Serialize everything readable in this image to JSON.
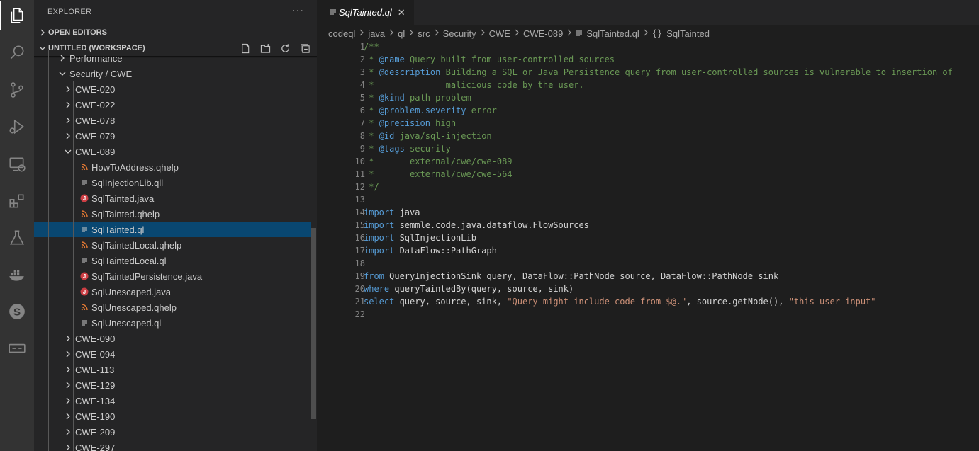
{
  "sidebar": {
    "title": "EXPLORER",
    "more": "···",
    "open_editors": "OPEN EDITORS",
    "workspace": "UNTITLED (WORKSPACE)",
    "tree": [
      {
        "label": "Performance",
        "kind": "folder",
        "depth": 2,
        "expanded": false
      },
      {
        "label": "Security / CWE",
        "kind": "folder",
        "depth": 2,
        "expanded": true
      },
      {
        "label": "CWE-020",
        "kind": "folder",
        "depth": 3,
        "expanded": false
      },
      {
        "label": "CWE-022",
        "kind": "folder",
        "depth": 3,
        "expanded": false
      },
      {
        "label": "CWE-078",
        "kind": "folder",
        "depth": 3,
        "expanded": false
      },
      {
        "label": "CWE-079",
        "kind": "folder",
        "depth": 3,
        "expanded": false
      },
      {
        "label": "CWE-089",
        "kind": "folder",
        "depth": 3,
        "expanded": true
      },
      {
        "label": "HowToAddress.qhelp",
        "kind": "rss",
        "depth": 4
      },
      {
        "label": "SqlInjectionLib.qll",
        "kind": "text",
        "depth": 4
      },
      {
        "label": "SqlTainted.java",
        "kind": "java",
        "depth": 4
      },
      {
        "label": "SqlTainted.qhelp",
        "kind": "rss",
        "depth": 4
      },
      {
        "label": "SqlTainted.ql",
        "kind": "text",
        "depth": 4,
        "selected": true
      },
      {
        "label": "SqlTaintedLocal.qhelp",
        "kind": "rss",
        "depth": 4
      },
      {
        "label": "SqlTaintedLocal.ql",
        "kind": "text",
        "depth": 4
      },
      {
        "label": "SqlTaintedPersistence.java",
        "kind": "java",
        "depth": 4
      },
      {
        "label": "SqlUnescaped.java",
        "kind": "java",
        "depth": 4
      },
      {
        "label": "SqlUnescaped.qhelp",
        "kind": "rss",
        "depth": 4
      },
      {
        "label": "SqlUnescaped.ql",
        "kind": "text",
        "depth": 4
      },
      {
        "label": "CWE-090",
        "kind": "folder",
        "depth": 3,
        "expanded": false
      },
      {
        "label": "CWE-094",
        "kind": "folder",
        "depth": 3,
        "expanded": false
      },
      {
        "label": "CWE-113",
        "kind": "folder",
        "depth": 3,
        "expanded": false
      },
      {
        "label": "CWE-129",
        "kind": "folder",
        "depth": 3,
        "expanded": false
      },
      {
        "label": "CWE-134",
        "kind": "folder",
        "depth": 3,
        "expanded": false
      },
      {
        "label": "CWE-190",
        "kind": "folder",
        "depth": 3,
        "expanded": false
      },
      {
        "label": "CWE-209",
        "kind": "folder",
        "depth": 3,
        "expanded": false
      },
      {
        "label": "CWE-297",
        "kind": "folder",
        "depth": 3,
        "expanded": false
      }
    ]
  },
  "editor": {
    "tab_label": "SqlTainted.ql",
    "breadcrumb": [
      "codeql",
      "java",
      "ql",
      "src",
      "Security",
      "CWE",
      "CWE-089",
      "SqlTainted.ql",
      "SqlTainted"
    ],
    "lines": [
      [
        [
          "c-com",
          "/**"
        ]
      ],
      [
        [
          "c-com",
          " * "
        ],
        [
          "c-tag",
          "@name"
        ],
        [
          "c-com",
          " Query built from user-controlled sources"
        ]
      ],
      [
        [
          "c-com",
          " * "
        ],
        [
          "c-tag",
          "@description"
        ],
        [
          "c-com",
          " Building a SQL or Java Persistence query from user-controlled sources is vulnerable to insertion of"
        ]
      ],
      [
        [
          "c-com",
          " *              malicious code by the user."
        ]
      ],
      [
        [
          "c-com",
          " * "
        ],
        [
          "c-tag",
          "@kind"
        ],
        [
          "c-com",
          " path-problem"
        ]
      ],
      [
        [
          "c-com",
          " * "
        ],
        [
          "c-tag",
          "@problem.severity"
        ],
        [
          "c-com",
          " error"
        ]
      ],
      [
        [
          "c-com",
          " * "
        ],
        [
          "c-tag",
          "@precision"
        ],
        [
          "c-com",
          " high"
        ]
      ],
      [
        [
          "c-com",
          " * "
        ],
        [
          "c-tag",
          "@id"
        ],
        [
          "c-com",
          " java/sql-injection"
        ]
      ],
      [
        [
          "c-com",
          " * "
        ],
        [
          "c-tag",
          "@tags"
        ],
        [
          "c-com",
          " security"
        ]
      ],
      [
        [
          "c-com",
          " *       external/cwe/cwe-089"
        ]
      ],
      [
        [
          "c-com",
          " *       external/cwe/cwe-564"
        ]
      ],
      [
        [
          "c-com",
          " */"
        ]
      ],
      [],
      [
        [
          "c-kw",
          "import"
        ],
        [
          "c-id",
          " java"
        ]
      ],
      [
        [
          "c-kw",
          "import"
        ],
        [
          "c-id",
          " semmle.code.java.dataflow.FlowSources"
        ]
      ],
      [
        [
          "c-kw",
          "import"
        ],
        [
          "c-id",
          " SqlInjectionLib"
        ]
      ],
      [
        [
          "c-kw",
          "import"
        ],
        [
          "c-id",
          " DataFlow::PathGraph"
        ]
      ],
      [],
      [
        [
          "c-kw",
          "from"
        ],
        [
          "c-id",
          " QueryInjectionSink query, DataFlow::PathNode source, DataFlow::PathNode sink"
        ]
      ],
      [
        [
          "c-kw",
          "where"
        ],
        [
          "c-id",
          " queryTaintedBy(query, source, sink)"
        ]
      ],
      [
        [
          "c-kw",
          "select"
        ],
        [
          "c-id",
          " query, source, sink, "
        ],
        [
          "c-str",
          "\"Query might include code from $@.\""
        ],
        [
          "c-id",
          ", source.getNode(), "
        ],
        [
          "c-str",
          "\"this user input\""
        ]
      ],
      []
    ]
  }
}
